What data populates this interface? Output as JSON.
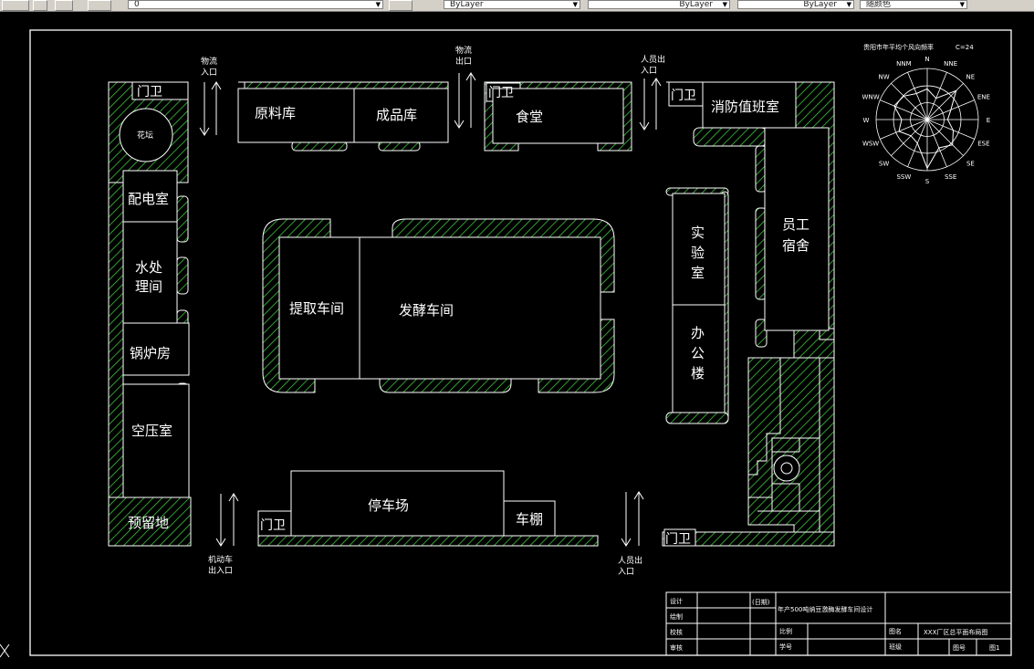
{
  "toolbar": {
    "layer_value": "0",
    "linetype_value": "ByLayer",
    "lineweight_value": "ByLayer",
    "plotstyle_value": "ByLayer",
    "color_value": "随颜色"
  },
  "plan": {
    "gates": [
      "门卫",
      "门卫",
      "门卫",
      "门卫",
      "门卫"
    ],
    "flowerbed": "花坛",
    "rooms": {
      "raw_material": "原料库",
      "finished_goods": "成品库",
      "canteen": "食堂",
      "fire_duty": "消防值班室",
      "power_room": "配电室",
      "water_treatment": [
        "水处",
        "理间"
      ],
      "boiler_room": "锅炉房",
      "air_compressor": "空压室",
      "reserved_land": "预留地",
      "extraction_workshop": "提取车间",
      "fermentation_workshop": "发酵车间",
      "lab": [
        "实",
        "验",
        "室"
      ],
      "office": [
        "办",
        "公",
        "楼"
      ],
      "dormitory": [
        "员工",
        "宿舍"
      ],
      "parking": "停车场",
      "shed": "车棚"
    },
    "entrances": {
      "logistics_in": [
        "物流",
        "入口"
      ],
      "logistics_out": [
        "物流",
        "出口"
      ],
      "people_top": [
        "人员出",
        "入口"
      ],
      "vehicle": [
        "机动车",
        "出入口"
      ],
      "people_bottom": [
        "人员出",
        "入口"
      ]
    }
  },
  "wind_rose": {
    "title": "贵阳市年平均个风向频率",
    "calm": "C=24",
    "directions": [
      "N",
      "NNE",
      "NE",
      "ENE",
      "E",
      "ESE",
      "SE",
      "SSE",
      "S",
      "SSW",
      "SW",
      "WSW",
      "W",
      "WNW",
      "NW",
      "NNM"
    ]
  },
  "title_block": {
    "design": "设计",
    "draw": "绘制",
    "check": "校核",
    "review": "审核",
    "date": "(日期)",
    "project": "年产500吨纳豆激酶发酵车间设计",
    "scale": "比例",
    "student_id": "学号",
    "drawing_name_label": "图名",
    "drawing_name": "XXX厂区总平面布局图",
    "class_label": "班级",
    "drawing_no_label": "图号",
    "drawing_no": "图1"
  }
}
